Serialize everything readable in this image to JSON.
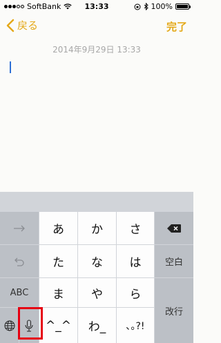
{
  "status_bar": {
    "carrier": "SoftBank",
    "time": "13:33",
    "battery": "100%",
    "battery_level": 1.0
  },
  "nav": {
    "back_label": "戻る",
    "done_label": "完了"
  },
  "note": {
    "date": "2014年9月29日 13:33"
  },
  "keyboard": {
    "keys": {
      "a": "あ",
      "ka": "か",
      "sa": "さ",
      "ta": "た",
      "na": "な",
      "ha": "は",
      "ma": "ま",
      "ya": "や",
      "ra": "ら",
      "emoticon": "^_^",
      "wa": "わ_",
      "punct": "､｡?!",
      "abc": "ABC",
      "space": "空白",
      "return": "改行"
    }
  },
  "colors": {
    "accent": "#e4a91a",
    "cursor": "#2e6fd6",
    "highlight": "#e60012"
  }
}
